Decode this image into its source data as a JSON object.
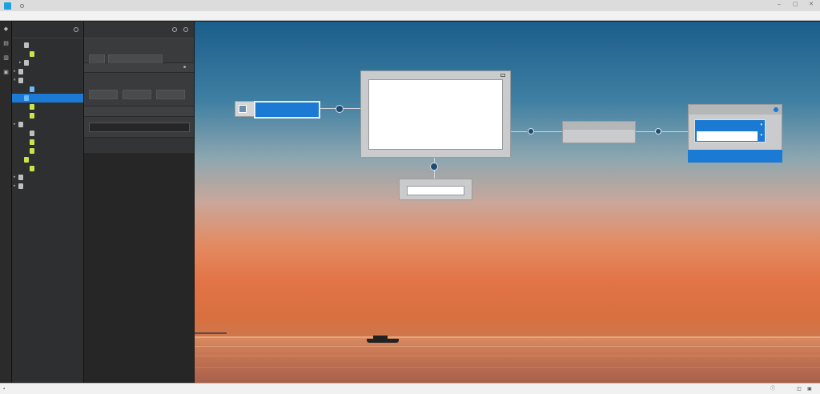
{
  "window": {
    "title": "",
    "controls": [
      "minimize-icon",
      "restore-icon",
      "close-icon"
    ]
  },
  "menubar": {
    "items": [
      "",
      "",
      "",
      "",
      "",
      "",
      "",
      "",
      ""
    ]
  },
  "rail": {
    "icons": [
      "layers-icon",
      "file-icon",
      "database-icon",
      "settings-icon"
    ]
  },
  "tree": {
    "title": "",
    "items": [
      {
        "label": "",
        "indent": 1,
        "icon": "grey",
        "toggle": "",
        "selected": false
      },
      {
        "label": "",
        "indent": 2,
        "icon": "green",
        "toggle": "",
        "selected": false
      },
      {
        "label": "",
        "indent": 1,
        "icon": "grey",
        "toggle": "▸",
        "selected": false
      },
      {
        "label": "",
        "indent": 0,
        "icon": "grey",
        "toggle": "▸",
        "selected": false
      },
      {
        "label": "",
        "indent": 0,
        "icon": "grey",
        "toggle": "▾",
        "selected": false
      },
      {
        "label": "",
        "indent": 2,
        "icon": "blue",
        "toggle": "",
        "selected": false
      },
      {
        "label": "",
        "indent": 1,
        "icon": "blue",
        "toggle": "",
        "selected": true
      },
      {
        "label": "",
        "indent": 2,
        "icon": "green",
        "toggle": "",
        "selected": false
      },
      {
        "label": "",
        "indent": 2,
        "icon": "green",
        "toggle": "",
        "selected": false
      },
      {
        "label": "",
        "indent": 0,
        "icon": "grey",
        "toggle": "▸",
        "selected": false
      },
      {
        "label": "",
        "indent": 2,
        "icon": "grey",
        "toggle": "",
        "selected": false
      },
      {
        "label": "",
        "indent": 2,
        "icon": "green",
        "toggle": "",
        "selected": false
      },
      {
        "label": "",
        "indent": 2,
        "icon": "green",
        "toggle": "",
        "selected": false
      },
      {
        "label": "",
        "indent": 1,
        "icon": "green",
        "toggle": "",
        "selected": false
      },
      {
        "label": "",
        "indent": 2,
        "icon": "green",
        "toggle": "",
        "selected": false
      },
      {
        "label": "",
        "indent": 0,
        "icon": "grey",
        "toggle": "▸",
        "selected": false
      },
      {
        "label": "",
        "indent": 0,
        "icon": "grey",
        "toggle": "▸",
        "selected": false
      }
    ]
  },
  "props": {
    "title": "",
    "section1_title": "",
    "name_label": "",
    "name_value": "",
    "section2_title": "",
    "col1_label": "",
    "col2_label": "",
    "col3_label": "",
    "col1_value": "",
    "col2_value": "",
    "col3_value": "",
    "section3_title": "",
    "row_label": "",
    "row_value": ""
  },
  "canvas": {
    "source_node_label": "",
    "code_lines": [
      {
        "text": "",
        "color": "#5a55d6"
      },
      {
        "text": "",
        "color": "#e0783a"
      },
      {
        "text": "",
        "color": "#5a55d6"
      },
      {
        "text": "",
        "color": "#b24ad0"
      }
    ],
    "branch_node_label": "",
    "middle_node_label": "",
    "target_node_title": "",
    "target_field_label": "",
    "target_field_value": "",
    "target_footer_left": "",
    "target_footer_right": ""
  },
  "statusbar": {
    "left_text": "",
    "right_icons": [
      "info-icon",
      "notification-icon"
    ]
  },
  "colors": {
    "accent": "#1a7ad4",
    "sky_top": "#1b5e8c",
    "sunset": "#e27447"
  }
}
